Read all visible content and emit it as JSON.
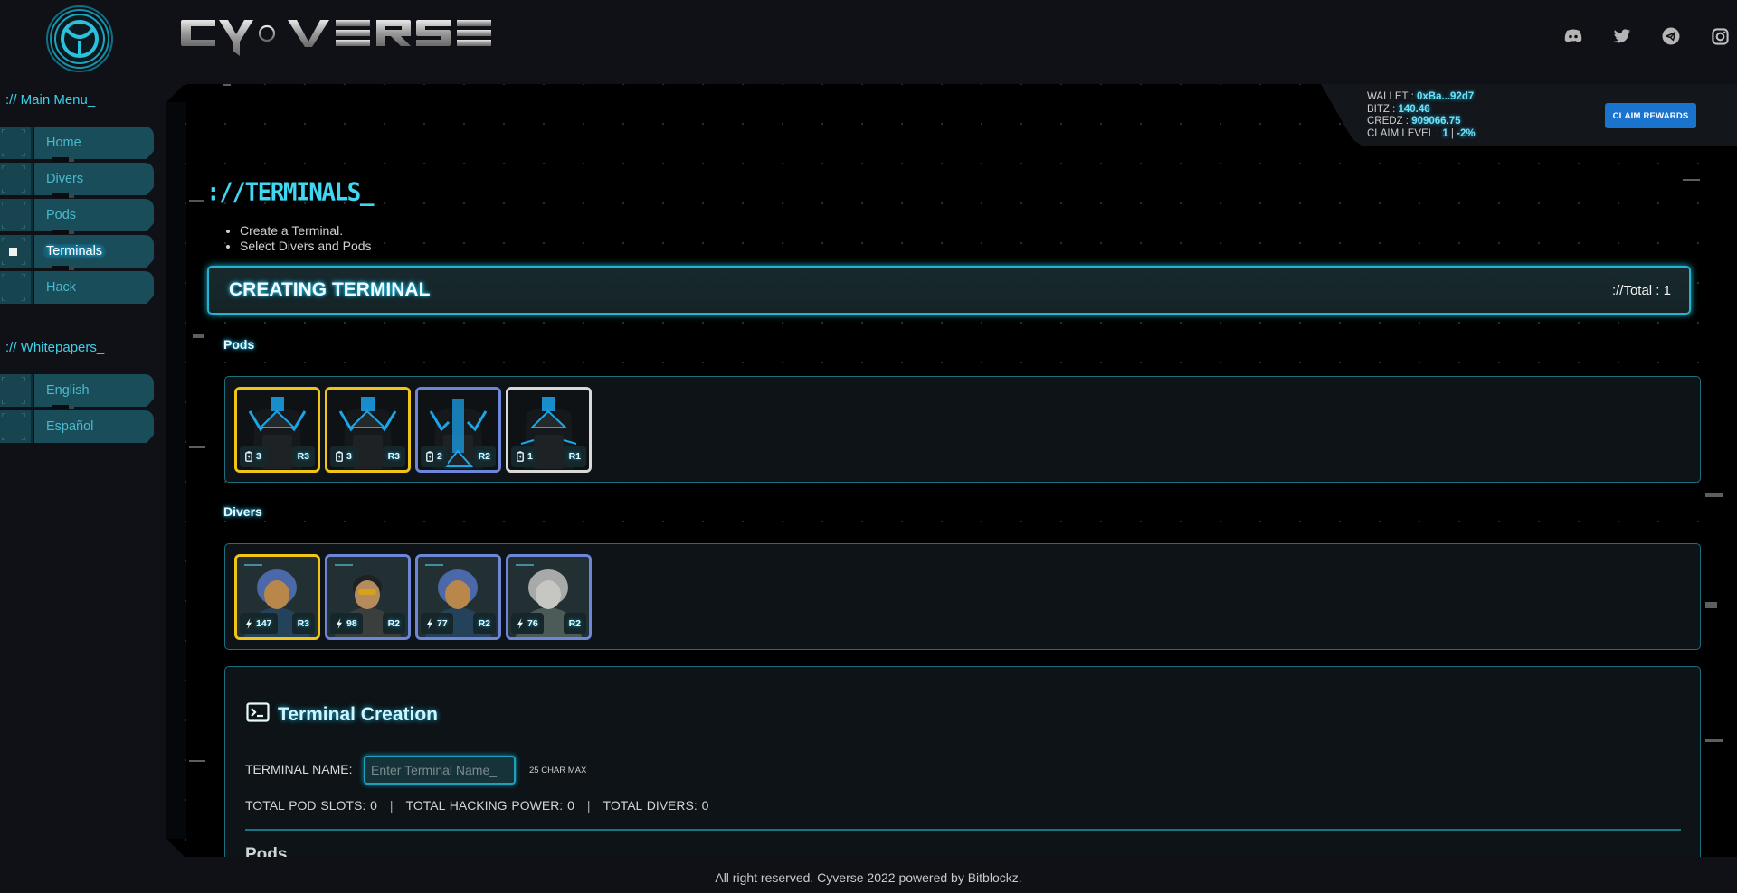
{
  "header": {
    "brand": "CYVERSE",
    "social": [
      {
        "name": "discord-icon"
      },
      {
        "name": "twitter-icon"
      },
      {
        "name": "telegram-icon"
      },
      {
        "name": "instagram-icon"
      }
    ]
  },
  "sidebar": {
    "main_menu_title": ":// Main Menu_",
    "main_items": [
      {
        "label": "Home",
        "active": false
      },
      {
        "label": "Divers",
        "active": false
      },
      {
        "label": "Pods",
        "active": false
      },
      {
        "label": "Terminals",
        "active": true
      },
      {
        "label": "Hack",
        "active": false
      }
    ],
    "whitepapers_title": ":// Whitepapers_",
    "whitepaper_items": [
      {
        "label": "English"
      },
      {
        "label": "Español"
      }
    ]
  },
  "wallet": {
    "wallet_label": "WALLET : ",
    "wallet_value": "0xBa...92d7",
    "bitz_label": "BITZ : ",
    "bitz_value": "140.46",
    "credz_label": "CREDZ : ",
    "credz_value": "909066.75",
    "claim_level_label": "CLAIM LEVEL : ",
    "claim_level_value": "1",
    "claim_level_sep": " | ",
    "claim_level_pct": "-2%",
    "claim_button": "CLAIM REWARDS"
  },
  "page": {
    "title": "://TERMINALS_",
    "instructions": [
      "Create a Terminal.",
      "Select Divers and Pods"
    ],
    "creating_title": "CREATING TERMINAL",
    "total_text": "://Total : 1"
  },
  "pods": {
    "label": "Pods",
    "items": [
      {
        "slots": "3",
        "rarity": "R3"
      },
      {
        "slots": "3",
        "rarity": "R3"
      },
      {
        "slots": "2",
        "rarity": "R2"
      },
      {
        "slots": "1",
        "rarity": "R1"
      }
    ]
  },
  "divers": {
    "label": "Divers",
    "items": [
      {
        "power": "147",
        "rarity": "R3"
      },
      {
        "power": "98",
        "rarity": "R2"
      },
      {
        "power": "77",
        "rarity": "R2"
      },
      {
        "power": "76",
        "rarity": "R2"
      }
    ]
  },
  "creation": {
    "title": "Terminal Creation",
    "name_label": "TERMINAL NAME:",
    "name_value": "",
    "name_placeholder": "Enter Terminal Name_",
    "char_max": "25 CHAR MAX",
    "total_pod_slots": "TOTAL POD SLOTS: 0",
    "total_hacking_power": "TOTAL HACKING POWER: 0",
    "total_divers": "TOTAL DIVERS: 0",
    "separator": "|",
    "pods_subheading": "Pods"
  },
  "footer": {
    "text": "All right reserved. Cyverse 2022 powered by Bitblockz."
  },
  "colors": {
    "accent": "#3fd7f2",
    "claim_button": "#1a73cc",
    "rarity_r3": "#f0c419",
    "rarity_r2": "#6d86d8",
    "rarity_r1": "#d9d9d9"
  }
}
